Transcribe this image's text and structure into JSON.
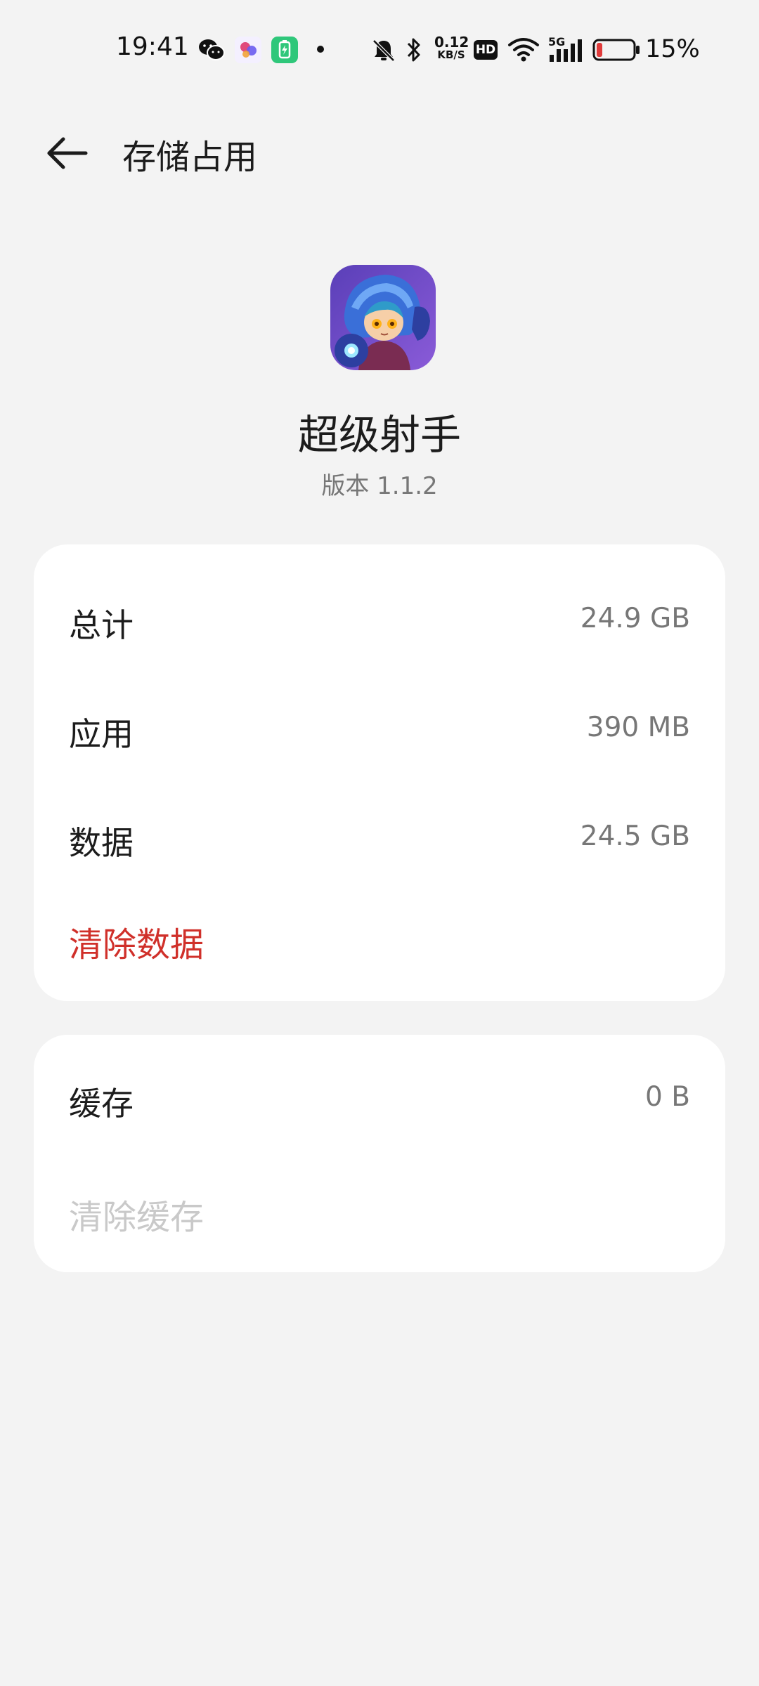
{
  "status_bar": {
    "time": "19:41",
    "net_speed_value": "0.12",
    "net_speed_unit": "KB/S",
    "hd_label": "HD",
    "network_label": "5G",
    "battery_percent": "15%",
    "battery_level": 0.15,
    "icons": [
      "wechat-icon",
      "app-notification-icon",
      "battery-saver-icon",
      "dot-icon",
      "mute-icon",
      "bluetooth-icon",
      "hd-icon",
      "wifi-icon",
      "signal-icon",
      "battery-icon"
    ]
  },
  "header": {
    "back_icon": "arrow-left-icon",
    "title": "存储占用"
  },
  "app": {
    "name": "超级射手",
    "version": "版本  1.1.2"
  },
  "storage": {
    "rows": [
      {
        "label": "总计",
        "value": "24.9 GB"
      },
      {
        "label": "应用",
        "value": "390 MB"
      },
      {
        "label": "数据",
        "value": "24.5 GB"
      }
    ],
    "clear_data_label": "清除数据"
  },
  "cache": {
    "label": "缓存",
    "value": "0 B",
    "clear_cache_label": "清除缓存"
  },
  "colors": {
    "background": "#f3f3f3",
    "card": "#ffffff",
    "danger": "#d0302a",
    "disabled": "#c9c9c9",
    "secondary_text": "#777777"
  }
}
